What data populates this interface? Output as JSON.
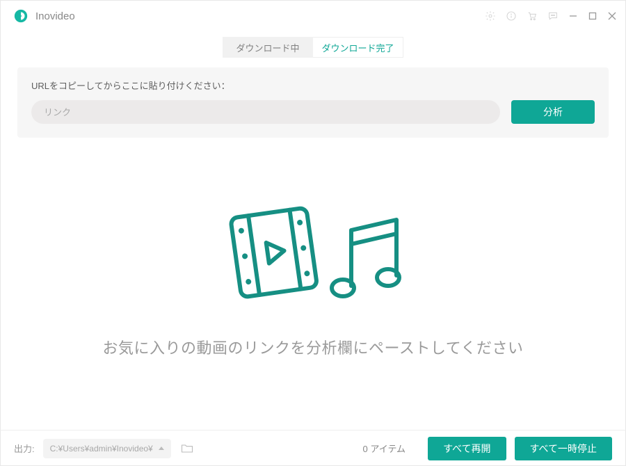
{
  "app": {
    "title": "Inovideo"
  },
  "tabs": {
    "downloading": "ダウンロード中",
    "completed": "ダウンロード完了"
  },
  "url_panel": {
    "label": "URLをコピーしてからここに貼り付けください：",
    "placeholder": "リンク",
    "analyze": "分析"
  },
  "empty_state": {
    "message": "お気に入りの動画のリンクを分析欄にペーストしてください"
  },
  "footer": {
    "output_label": "出力:",
    "output_path": "C:¥Users¥admin¥Inovideo¥",
    "item_count": "0 アイテム",
    "resume_all": "すべて再開",
    "pause_all": "すべて一時停止"
  },
  "colors": {
    "accent": "#0fa796"
  }
}
